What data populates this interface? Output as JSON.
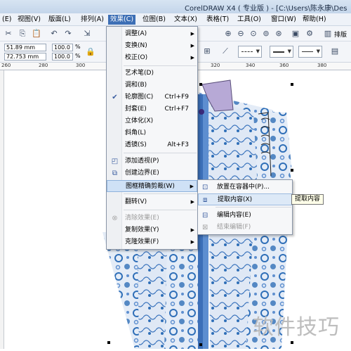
{
  "window": {
    "title": "CorelDRAW X4 ( 专业版 ) - [C:\\Users\\陈永康\\Des"
  },
  "menubar": {
    "items": [
      "(E)",
      "视图(V)",
      "版面(L)",
      "排列(A)",
      "效果(C)",
      "位图(B)",
      "文本(X)",
      "表格(T)",
      "工具(O)",
      "窗口(W)",
      "帮助(H)"
    ],
    "active": "效果(C)"
  },
  "property_bar": {
    "x": "51.89 mm",
    "y": "72.753 mm",
    "scale_w": "100.0",
    "scale_h": "100.0",
    "pct": "%",
    "layout_label": "排版"
  },
  "ruler": {
    "labels": [
      "260",
      "280",
      "300",
      "320",
      "340",
      "360",
      "380"
    ]
  },
  "effects_menu": {
    "items": [
      {
        "label": "调整(A)",
        "submenu": true
      },
      {
        "label": "变换(N)",
        "submenu": true
      },
      {
        "label": "校正(O)",
        "submenu": true
      },
      {
        "label": "艺术笔(D)"
      },
      {
        "label": "调和(B)"
      },
      {
        "label": "轮廓图(C)",
        "shortcut": "Ctrl+F9",
        "checked": true
      },
      {
        "label": "封套(E)",
        "shortcut": "Ctrl+F7"
      },
      {
        "label": "立体化(X)"
      },
      {
        "label": "斜角(L)"
      },
      {
        "label": "透镜(S)",
        "shortcut": "Alt+F3"
      },
      {
        "label": "添加透视(P)"
      },
      {
        "label": "创建边界(E)"
      },
      {
        "label": "图框精确剪裁(W)",
        "submenu": true,
        "highlighted": true
      },
      {
        "label": "翻转(V)",
        "submenu": true
      },
      {
        "label": "清除效果(E)",
        "disabled": true
      },
      {
        "label": "复制效果(Y)",
        "submenu": true
      },
      {
        "label": "克隆效果(F)",
        "submenu": true
      }
    ]
  },
  "powerclip_submenu": {
    "items": [
      {
        "label": "放置在容器中(P)..."
      },
      {
        "label": "提取内容(X)",
        "highlighted": true
      },
      {
        "label": "编辑内容(E)"
      },
      {
        "label": "结束编辑(F)",
        "disabled": true
      }
    ]
  },
  "tooltip": "提取内容",
  "watermark": "软件技巧",
  "colors": {
    "menu_active": "#3d6fb5",
    "highlight": "#cfe1f6",
    "garment_blue": "#2f6fb8",
    "collar": "#b7a9d6"
  }
}
